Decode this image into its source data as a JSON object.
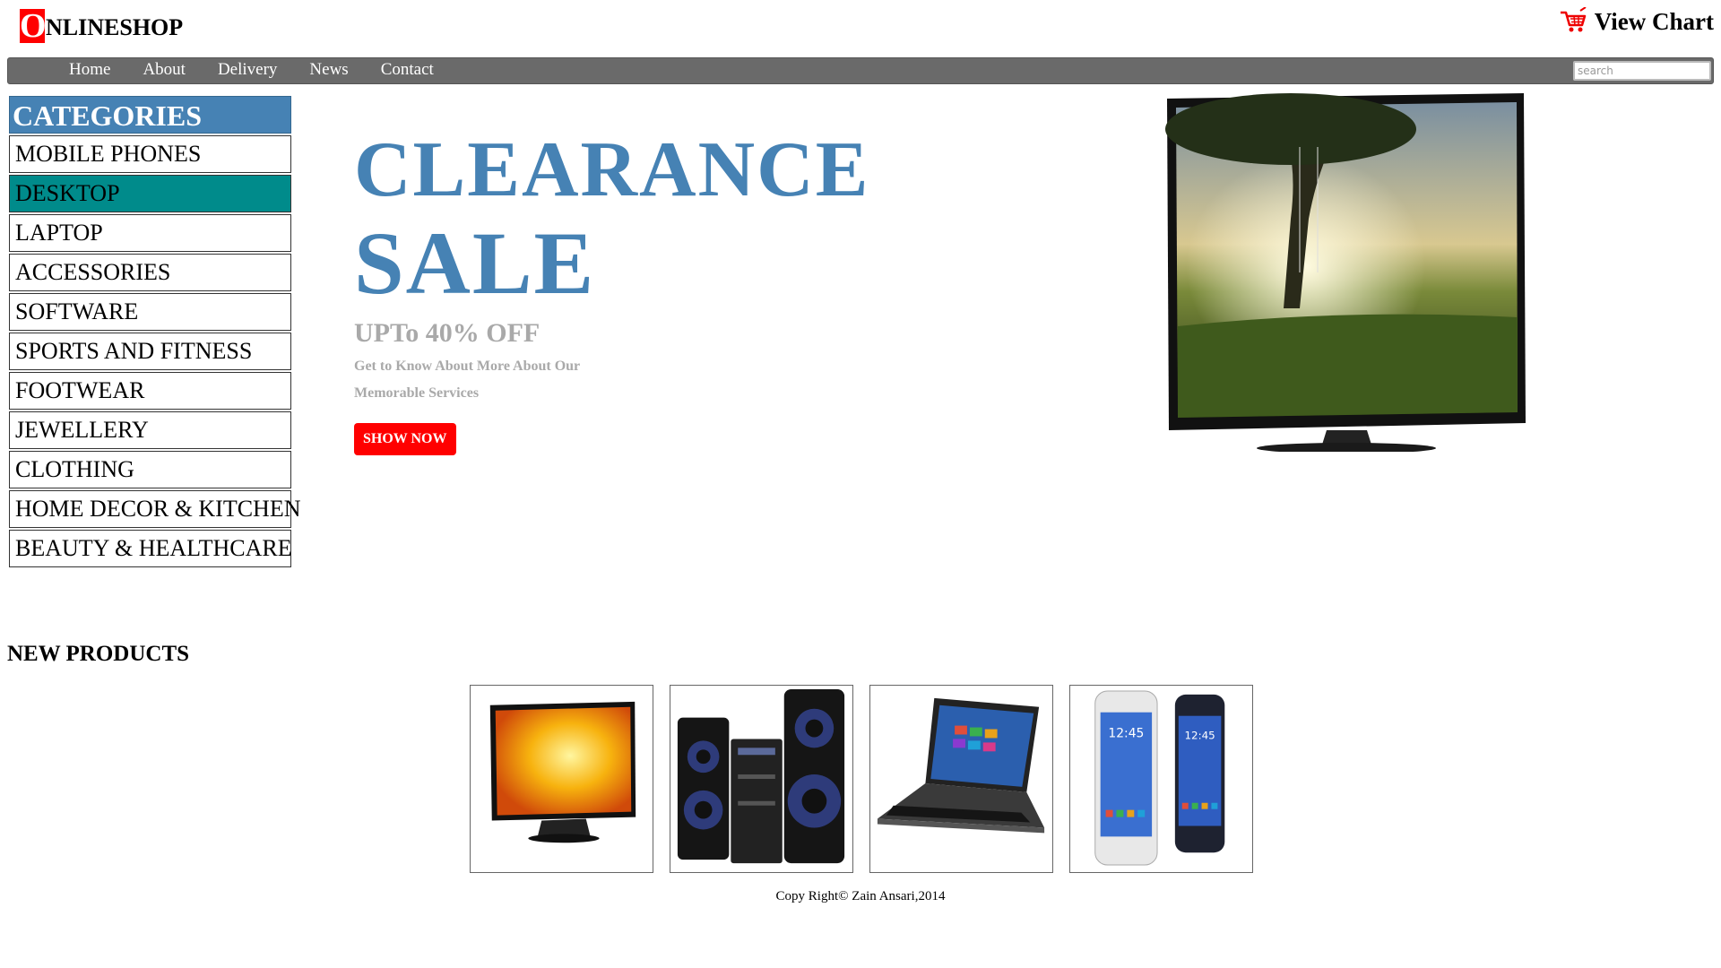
{
  "header": {
    "logo_letter": "O",
    "logo_text": "NLINESHOP",
    "cart_label": "View Chart",
    "cart_icon": "shopping-cart-icon",
    "logo_color": "#ff0000"
  },
  "nav": {
    "items": [
      "Home",
      "About",
      "Delivery",
      "News",
      "Contact"
    ],
    "search_placeholder": "search",
    "bar_color": "#6a6a6a"
  },
  "sidebar": {
    "title": "CATEGORIES",
    "items": [
      "MOBILE PHONES",
      "DESKTOP",
      "LAPTOP",
      "ACCESSORIES",
      "SOFTWARE",
      "SPORTS AND FITNESS",
      "FOOTWEAR",
      "JEWELLERY",
      "CLOTHING",
      "HOME DECOR & KITCHEN",
      "BEAUTY & HEALTHCARE"
    ],
    "active_item": "DESKTOP",
    "header_color": "#4682b4",
    "active_color": "#008b8b"
  },
  "hero": {
    "line1": "CLEARANCE",
    "line2": "SALE",
    "offer": "UPTo 40% OFF",
    "desc_line1": "Get to Know About More About Our",
    "desc_line2": "Memorable Services",
    "button_label": "SHOW NOW",
    "accent_color": "#4682b4",
    "button_color": "#ff0000"
  },
  "new_products": {
    "title": "NEW PRODUCTS",
    "items": [
      "tv-product-image",
      "speaker-system-product-image",
      "laptop-product-image",
      "smartphone-product-image"
    ]
  },
  "footer": {
    "copyright": "Copy Right© Zain Ansari,2014"
  }
}
